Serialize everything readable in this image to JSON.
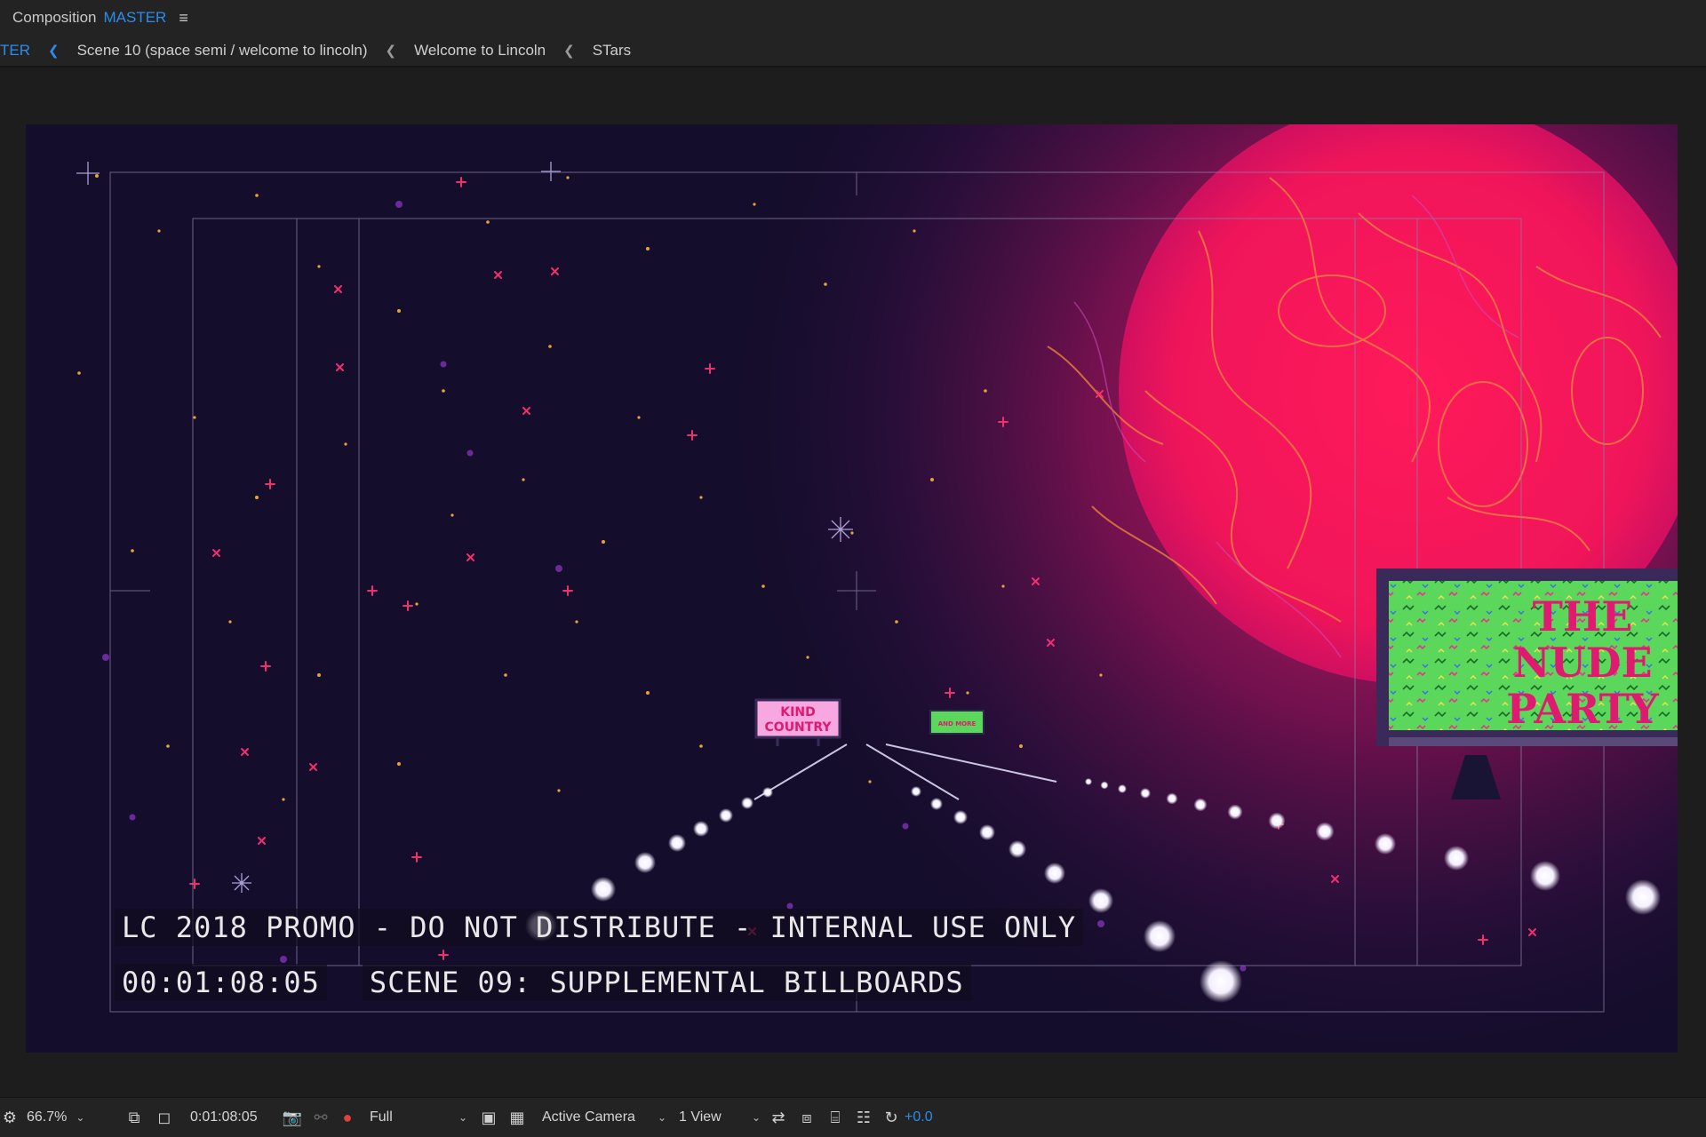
{
  "panel": {
    "title_prefix": "Composition",
    "comp_name": "MASTER"
  },
  "breadcrumb": {
    "items": [
      {
        "label": "TER",
        "active": true
      },
      {
        "label": "Scene 10 (space semi / welcome to lincoln)"
      },
      {
        "label": "Welcome to Lincoln"
      },
      {
        "label": "STars"
      }
    ]
  },
  "viewer": {
    "billboards": {
      "left": {
        "line1": "KIND",
        "line2": "COUNTRY"
      },
      "middle": {
        "text": "AND MORE"
      },
      "right": {
        "line1": "THE",
        "line2": "NUDE",
        "line3": "PARTY"
      }
    },
    "burn_in": {
      "line1": "LC 2018 PROMO - DO NOT DISTRIBUTE - INTERNAL USE ONLY",
      "timecode": "00:01:08:05",
      "scene": "SCENE 09: SUPPLEMENTAL BILLBOARDS"
    }
  },
  "toolbar": {
    "zoom": "66.7%",
    "timecode": "0:01:08:05",
    "resolution": "Full",
    "camera": "Active Camera",
    "views": "1 View",
    "exposure": "+0.0"
  },
  "colors": {
    "accent": "#2d8ceb",
    "planet": "#f0185a",
    "billboard_green": "#5bd85b",
    "billboard_pink": "#f7a8e0",
    "space": "#150d2c"
  }
}
